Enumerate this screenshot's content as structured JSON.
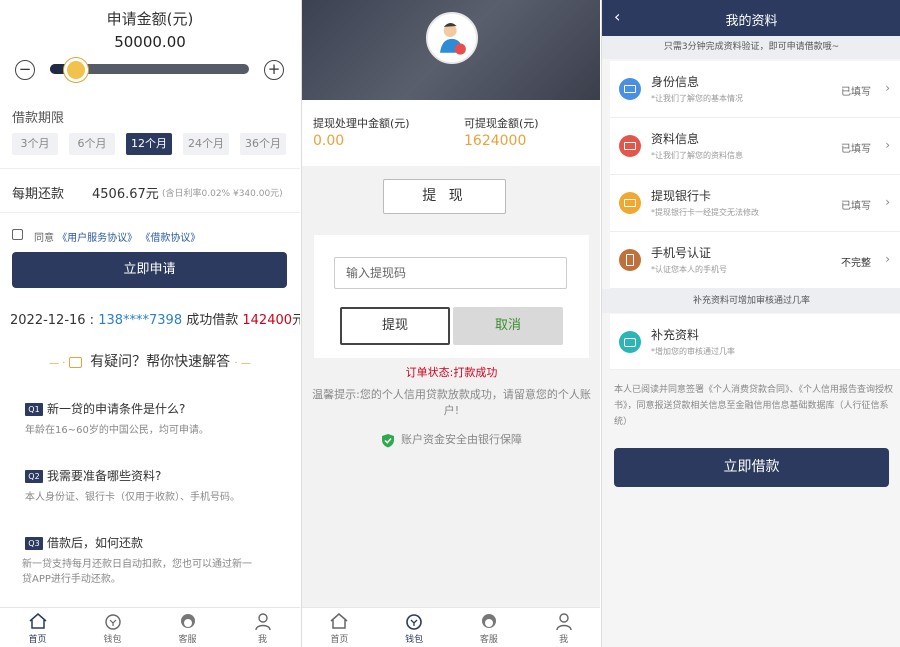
{
  "p1": {
    "amount_title": "申请金额(元)",
    "amount_value": "50000.00",
    "minus": "−",
    "plus": "+",
    "slider_fraction": 0.1,
    "term_label": "借款期限",
    "terms": [
      "3个月",
      "6个月",
      "12个月",
      "24个月",
      "36个月"
    ],
    "selected_term": "12个月",
    "repay_label": "每期还款",
    "repay_value": "4506.67元",
    "repay_note": "(含日利率0.02% ¥340.00元)",
    "agree_prefix": "同意",
    "agree_link1": "《用户服务协议》",
    "agree_link2": "《借款协议》",
    "apply_button": "立即申请",
    "marquee_date": "2022-12-16 : ",
    "marquee_phone": "138****7398",
    "marquee_mid": " 成功借款 ",
    "marquee_amount": "142400",
    "marquee_unit": "元!",
    "faq_title": "有疑问？帮你快速解答",
    "faq": [
      {
        "badge": "Q1",
        "q": "新一贷的申请条件是什么?",
        "a": "年龄在16~60岁的中国公民，均可申请。"
      },
      {
        "badge": "Q2",
        "q": "我需要准备哪些资料?",
        "a": "本人身份证、银行卡（仅用于收款）、手机号码。"
      },
      {
        "badge": "Q3",
        "q": "借款后，如何还款",
        "a": "新一贷支持每月还款日自动扣款，您也可以通过新一贷APP进行手动还款。"
      }
    ],
    "tabs": [
      {
        "label": "首页",
        "icon": "home-icon"
      },
      {
        "label": "钱包",
        "icon": "wallet-icon"
      },
      {
        "label": "客服",
        "icon": "service-icon"
      },
      {
        "label": "我",
        "icon": "user-icon"
      }
    ],
    "active_tab": "首页"
  },
  "p2": {
    "pending_label": "提现处理中金额(元)",
    "pending_value": "0.00",
    "available_label": "可提现金额(元)",
    "available_value": "1624000",
    "withdraw_button": "提 现",
    "code_placeholder": "输入提现码",
    "confirm_button": "提现",
    "cancel_button": "取消",
    "status": "订单状态:打款成功",
    "tip": "温馨提示:您的个人信用贷款放款成功，请留意您的个人账户!",
    "safe": "账户资金安全由银行保障",
    "tabs": [
      {
        "label": "首页",
        "icon": "home-icon"
      },
      {
        "label": "钱包",
        "icon": "wallet-icon"
      },
      {
        "label": "客服",
        "icon": "service-icon"
      },
      {
        "label": "我",
        "icon": "user-icon"
      }
    ],
    "active_tab": "钱包"
  },
  "p3": {
    "back": "‹",
    "title": "我的资料",
    "banner": "只需3分钟完成资料验证，即可申请借款哦~",
    "rows": [
      {
        "name": "身份信息",
        "desc": "*让我们了解您的基本情况",
        "status": "已填写",
        "color": "#4a90e2",
        "icon": "id-card-icon"
      },
      {
        "name": "资料信息",
        "desc": "*让我们了解您的资料信息",
        "status": "已填写",
        "color": "#e2574c",
        "icon": "profile-card-icon"
      },
      {
        "name": "提现银行卡",
        "desc": "*提现银行卡一经提交无法修改",
        "status": "已填写",
        "color": "#f0a830",
        "icon": "bank-card-icon"
      },
      {
        "name": "手机号认证",
        "desc": "*认证您本人的手机号",
        "status": "不完整",
        "color": "#c0703a",
        "icon": "phone-icon"
      }
    ],
    "section_label": "补充资料可增加审核通过几率",
    "extra": {
      "name": "补充资料",
      "desc": "*增加您的审核通过几率",
      "color": "#2bb5b5",
      "icon": "camera-icon"
    },
    "legal": "本人已阅读并同意签署《个人消费贷款合同》、《个人信用报告查询授权书》，同意报送贷款相关信息至金融信用信息基础数据库（人行征信系统）",
    "submit_button": "立即借款"
  }
}
